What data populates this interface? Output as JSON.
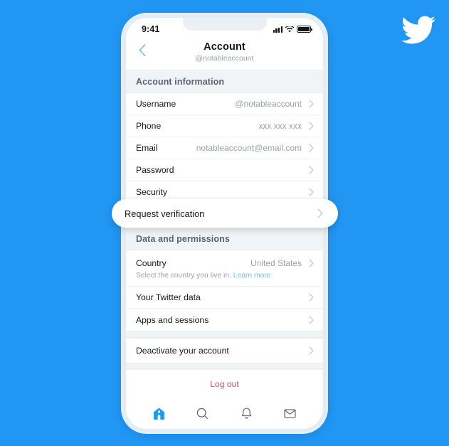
{
  "background_color": "#2196f3",
  "brand": {
    "logo_icon": "twitter-bird-icon",
    "logo_color": "#ffffff"
  },
  "phone": {
    "status_bar": {
      "time": "9:41",
      "signal_icon": "cellular-signal-icon",
      "wifi_icon": "wifi-icon",
      "battery_icon": "battery-full-icon"
    },
    "nav": {
      "back_icon": "chevron-left-icon",
      "title": "Account",
      "subtitle": "@notableaccount"
    },
    "sections": [
      {
        "header": "Account information",
        "rows": [
          {
            "label": "Username",
            "value": "@notableaccount",
            "chevron_icon": "chevron-right-icon"
          },
          {
            "label": "Phone",
            "value": "xxx xxx xxx",
            "chevron_icon": "chevron-right-icon"
          },
          {
            "label": "Email",
            "value": "notableaccount@email.com",
            "chevron_icon": "chevron-right-icon"
          },
          {
            "label": "Password",
            "value": "",
            "chevron_icon": "chevron-right-icon"
          },
          {
            "label": "Security",
            "value": "",
            "chevron_icon": "chevron-right-icon"
          }
        ]
      },
      {
        "header": "Data and permissions",
        "rows": [
          {
            "label": "Country",
            "value": "United States",
            "chevron_icon": "chevron-right-icon"
          },
          {
            "label": "Your Twitter data",
            "value": "",
            "chevron_icon": "chevron-right-icon"
          },
          {
            "label": "Apps and sessions",
            "value": "",
            "chevron_icon": "chevron-right-icon"
          }
        ],
        "country_hint": "Select the country you live in. ",
        "country_hint_link": "Learn more"
      }
    ],
    "deactivate": {
      "label": "Deactivate your account",
      "chevron_icon": "chevron-right-icon"
    },
    "logout": {
      "label": "Log out",
      "color": "#c54f7c"
    },
    "tabbar": [
      {
        "icon": "home-icon",
        "active": true,
        "color": "#1d9bf0"
      },
      {
        "icon": "search-icon",
        "active": false,
        "color": "#5b6570"
      },
      {
        "icon": "bell-icon",
        "active": false,
        "color": "#5b6570"
      },
      {
        "icon": "envelope-icon",
        "active": false,
        "color": "#5b6570"
      }
    ]
  },
  "highlight": {
    "label": "Request verification",
    "chevron_icon": "chevron-right-icon"
  }
}
